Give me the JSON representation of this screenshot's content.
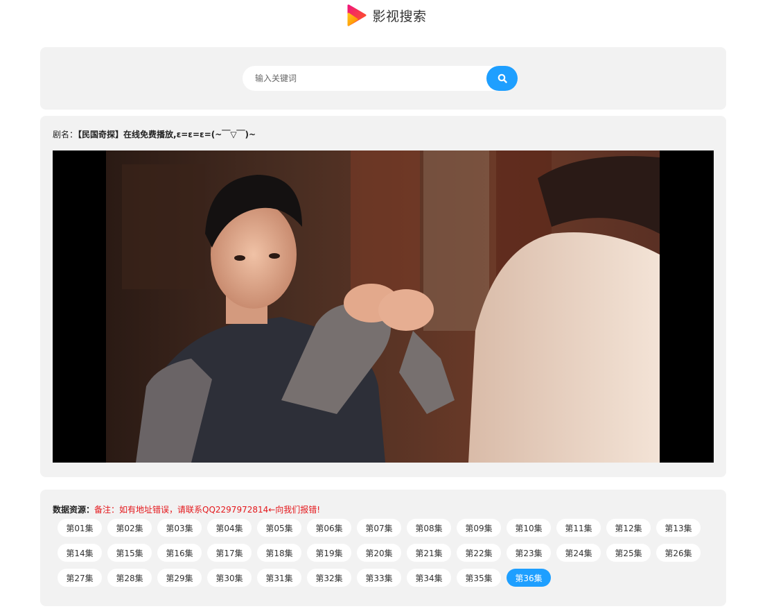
{
  "header": {
    "title": "影视搜索"
  },
  "search": {
    "placeholder": "输入关键词"
  },
  "player": {
    "title_label": "剧名：",
    "title_value": "【民国奇探】在线免费播放,ε=ε=ε=(~￣▽￣)~"
  },
  "episodes": {
    "source_label": "数据资源：",
    "note": "备注：如有地址错误，请联系QQ2297972814←向我们报错!",
    "items": [
      "第01集",
      "第02集",
      "第03集",
      "第04集",
      "第05集",
      "第06集",
      "第07集",
      "第08集",
      "第09集",
      "第10集",
      "第11集",
      "第12集",
      "第13集",
      "第14集",
      "第15集",
      "第16集",
      "第17集",
      "第18集",
      "第19集",
      "第20集",
      "第21集",
      "第22集",
      "第23集",
      "第24集",
      "第25集",
      "第26集",
      "第27集",
      "第28集",
      "第29集",
      "第30集",
      "第31集",
      "第32集",
      "第33集",
      "第34集",
      "第35集",
      "第36集"
    ],
    "active": "第36集"
  },
  "colors": {
    "accent": "#1e9fff",
    "note_red": "#e4171b",
    "card_bg": "#f2f2f2"
  },
  "icons": {
    "logo": "play-logo-icon",
    "search": "search-icon"
  }
}
